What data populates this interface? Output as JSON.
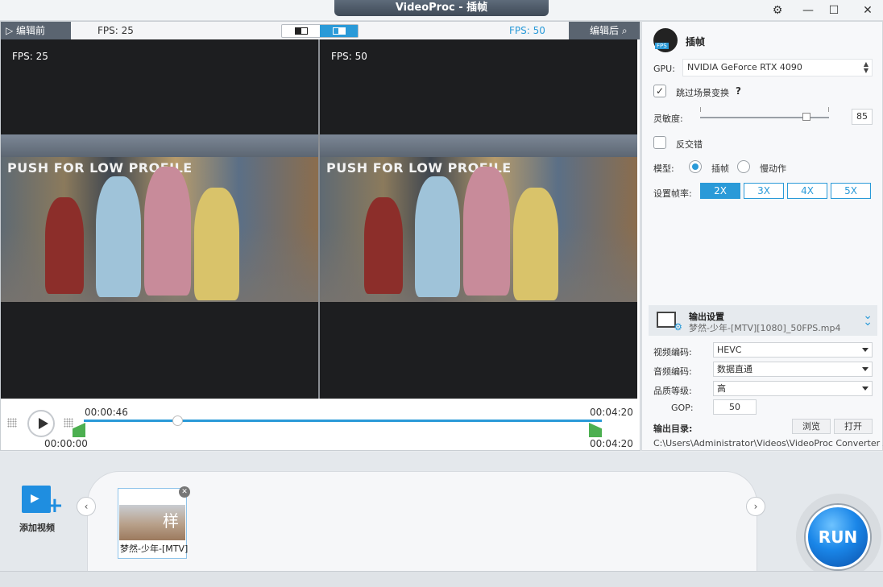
{
  "window": {
    "title": "VideoProc - 插帧"
  },
  "window_controls": {
    "settings": "⚙",
    "minimize": "—",
    "maximize": "☐",
    "close": "✕"
  },
  "preview": {
    "before_label": "▷ 编辑前",
    "after_label": "编辑后",
    "fps_before": "FPS: 25",
    "fps_after": "FPS: 50",
    "overlay_before": "FPS: 25",
    "overlay_after": "FPS: 50",
    "frame_banner": "PUSH FOR LOW PROFILE",
    "current_time": "00:00:46",
    "start_time": "00:00:00",
    "end_time_top": "00:04:20",
    "end_time_bottom": "00:04:20",
    "playhead_fraction": 0.18
  },
  "panel": {
    "title": "插帧",
    "gpu_label": "GPU:",
    "gpu_value": "NVIDIA GeForce RTX 4090",
    "skip_scene_label": "跳过场景变换",
    "skip_scene_checked": true,
    "help": "?",
    "sensitivity_label": "灵敏度:",
    "sensitivity_value": "85",
    "deinterlace_label": "反交错",
    "deinterlace_checked": false,
    "model_label": "模型:",
    "model_options": [
      "插帧",
      "慢动作"
    ],
    "model_selected": "插帧",
    "rate_label": "设置帧率:",
    "rates": [
      "2X",
      "3X",
      "4X",
      "5X"
    ],
    "rate_selected": "2X"
  },
  "output": {
    "title": "输出设置",
    "filename": "梦然-少年-[MTV][1080]_50FPS.mp4",
    "video_codec_label": "视频编码:",
    "video_codec": "HEVC",
    "audio_codec_label": "音频编码:",
    "audio_codec": "数据直通",
    "quality_label": "品质等级:",
    "quality": "高",
    "gop_label": "GOP:",
    "gop": "50",
    "dir_label": "输出目录:",
    "browse": "浏览",
    "open": "打开",
    "path": "C:\\Users\\Administrator\\Videos\\VideoProc Converter AI"
  },
  "bottom": {
    "add_video": "添加视频",
    "prev": "‹",
    "next": "›",
    "clip_label": "梦然-少年-[MTV]",
    "close": "✕",
    "run": "RUN"
  }
}
